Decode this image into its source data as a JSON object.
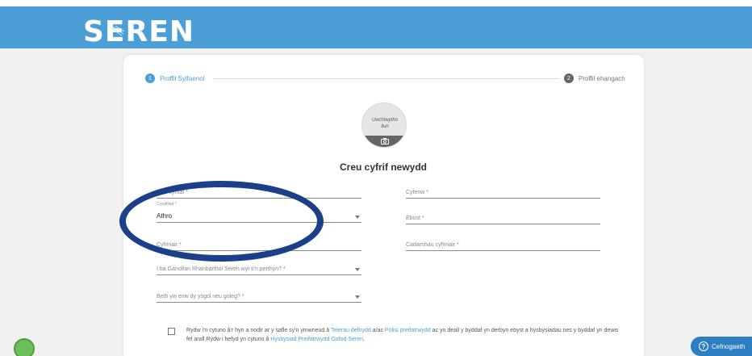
{
  "header": {
    "logo": "SEREN"
  },
  "steps": [
    {
      "num": "1",
      "label": "Proffil Sylfaenol"
    },
    {
      "num": "2",
      "label": "Proffil ehangach"
    }
  ],
  "avatar": {
    "upload_label_1": "Uwchlwytho",
    "upload_label_2": "llun",
    "icon": "camera-icon"
  },
  "form": {
    "title": "Creu cyfrif newydd",
    "first_name": "Enw cyntaf *",
    "surname": "Cyfenw *",
    "role_label": "Cysylltiad *",
    "role_value": "Athro",
    "email": "Ebost *",
    "password": "Cyfrinair *",
    "confirm_password": "Cadarnhau cyfrinair *",
    "hub": "I ba Ganolfan Rhanbarthol Seren wyt ti'n perthyn? *",
    "school": "Beth yw enw dy ysgol neu goleg? *"
  },
  "terms": {
    "part1": "Rydw i'n cytuno â'r hyn a nodir ar y safle sy'n ymwneud â ",
    "link1": "Telerau defnydd",
    "part2": " a/ac ",
    "link2": "Polisi preifatrwydd",
    "part3": " ac yn deall y byddaf yn derbyn ebyst a hysbysiadau nes y byddaf yn dewis fel arall.Rydw i hefyd yn cytuno â ",
    "link3": "Hysbysiad Preifatrwydd Gofod Seren",
    "part4": "."
  },
  "help": {
    "label": "Cefnogaeth",
    "icon": "question-icon"
  },
  "colors": {
    "brand": "#4c9fd6",
    "annotation": "#1c3f8a",
    "help": "#2e7fc1"
  }
}
